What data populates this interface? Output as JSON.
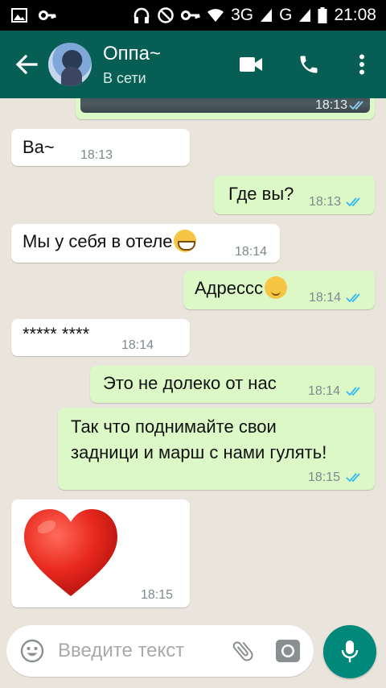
{
  "status_bar": {
    "network": "3G",
    "network2": "G",
    "time": "21:08"
  },
  "header": {
    "contact_name": "Оппа~",
    "status": "В сети"
  },
  "colors": {
    "header": "#075e54",
    "outgoing": "#dcf8c6",
    "incoming": "#ffffff",
    "ticks": "#34b7f1",
    "mic": "#00897b"
  },
  "messages": [
    {
      "direction": "out",
      "type": "image",
      "time": "18:13",
      "read": true
    },
    {
      "direction": "in",
      "text": "Ва~",
      "time": "18:13"
    },
    {
      "direction": "out",
      "text": "Где вы?",
      "time": "18:13",
      "read": true
    },
    {
      "direction": "in",
      "text": "Мы у себя в отеле",
      "emoji": "grinning-face",
      "time": "18:14"
    },
    {
      "direction": "out",
      "text": "Адрессс",
      "emoji": "smiling-face",
      "time": "18:14",
      "read": true
    },
    {
      "direction": "in",
      "text": "***** ****",
      "time": "18:14"
    },
    {
      "direction": "out",
      "text": "Это не долеко от нас",
      "time": "18:14",
      "read": true
    },
    {
      "direction": "out",
      "text_lines": [
        "Так что поднимайте свои",
        "задници и марш с нами гулять!"
      ],
      "time": "18:15",
      "read": true
    },
    {
      "direction": "in",
      "type": "sticker",
      "sticker": "red-heart",
      "time": "18:15"
    }
  ],
  "input": {
    "placeholder": "Введите текст"
  }
}
